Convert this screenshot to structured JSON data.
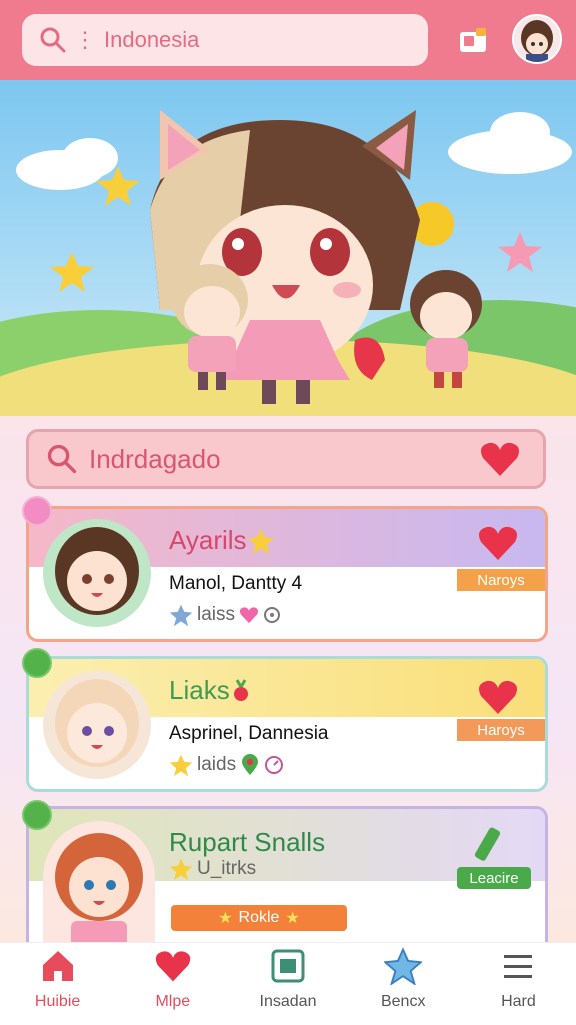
{
  "top_search": {
    "text": "Indonesia"
  },
  "featured_search": {
    "text": "Indrdagado"
  },
  "cards": [
    {
      "title": "Ayarils",
      "subtitle": "Manol, Dantty 4",
      "meta": "laiss",
      "tag": "Naroys"
    },
    {
      "title": "Liaks",
      "subtitle": "Asprinel, Dannesia",
      "meta": "laids",
      "tag": "Haroys"
    },
    {
      "title": "Rupart Snalls",
      "meta": "U_itrks",
      "tag": "Leacire",
      "progress_label": "Rokle",
      "progress_icon": "star-icon"
    }
  ],
  "nav": [
    {
      "label": "Huibie",
      "icon": "home-icon"
    },
    {
      "label": "Mlpe",
      "icon": "heart-icon"
    },
    {
      "label": "Insadan",
      "icon": "gallery-icon"
    },
    {
      "label": "Bencx",
      "icon": "star-icon"
    },
    {
      "label": "Hard",
      "icon": "menu-icon"
    }
  ],
  "colors": {
    "accent": "#f07a8e",
    "heart": "#e8334a",
    "nav_active": "#e84c5a"
  }
}
